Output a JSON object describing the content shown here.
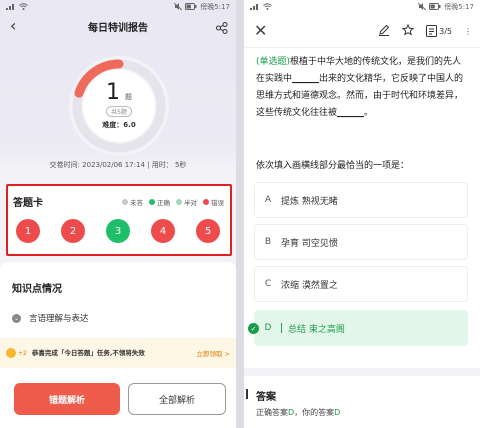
{
  "status": {
    "time": "傍晚5:17",
    "battery_pct": 62
  },
  "left": {
    "title": "每日特训报告",
    "score": "1",
    "score_unit": "题",
    "total": "共5题",
    "difficulty": "难度：6.0",
    "submit_info": "交卷时间: 2023/02/06 17:14 | 用时： 5秒",
    "answer_card": {
      "title": "答题卡",
      "legend": [
        {
          "label": "未答",
          "color": "#c8c8c8"
        },
        {
          "label": "正确",
          "color": "#1fbf6a"
        },
        {
          "label": "半对",
          "color": "#9ad9b8"
        },
        {
          "label": "错误",
          "color": "#ee4c4c"
        }
      ],
      "questions": [
        {
          "num": "1",
          "color": "#ee4c4c"
        },
        {
          "num": "2",
          "color": "#ee4c4c"
        },
        {
          "num": "3",
          "color": "#1fbf6a"
        },
        {
          "num": "4",
          "color": "#ee4c4c"
        },
        {
          "num": "5",
          "color": "#ee4c4c"
        }
      ],
      "correct_fraction": 0.2
    },
    "knowledge": {
      "title": "知识点情况",
      "item": "言语理解与表达"
    },
    "banner": {
      "plus": "+2",
      "text": "恭喜完成「今日答题」任务,不领将失效",
      "link": "立即领取 >"
    },
    "buttons": {
      "wrong_analysis": "错题解析",
      "all_analysis": "全部解析"
    }
  },
  "right": {
    "progress": "3/5",
    "question": {
      "type": "(单选题)",
      "text_before": "根植于中华大地的传统文化，是我们的先人在实践中",
      "blank1": "______",
      "text_mid": "出来的文化精华，它反映了中国人的思维方式和道德观念。然而，由于时代和环境差异，这些传统文化往往被",
      "blank2": "______",
      "text_end": "。",
      "prompt": "依次填入画横线部分最恰当的一项是："
    },
    "options": [
      {
        "letter": "A",
        "text": "提炼  熟视无睹",
        "correct": false
      },
      {
        "letter": "B",
        "text": "孕育  司空见惯",
        "correct": false
      },
      {
        "letter": "C",
        "text": "浓缩  漠然置之",
        "correct": false
      },
      {
        "letter": "D",
        "text": "总结  束之高阁",
        "correct": true
      }
    ],
    "answer": {
      "title": "答案",
      "label_correct": "正确答案",
      "correct": "D",
      "label_yours": "，你的答案",
      "yours": "D"
    }
  }
}
